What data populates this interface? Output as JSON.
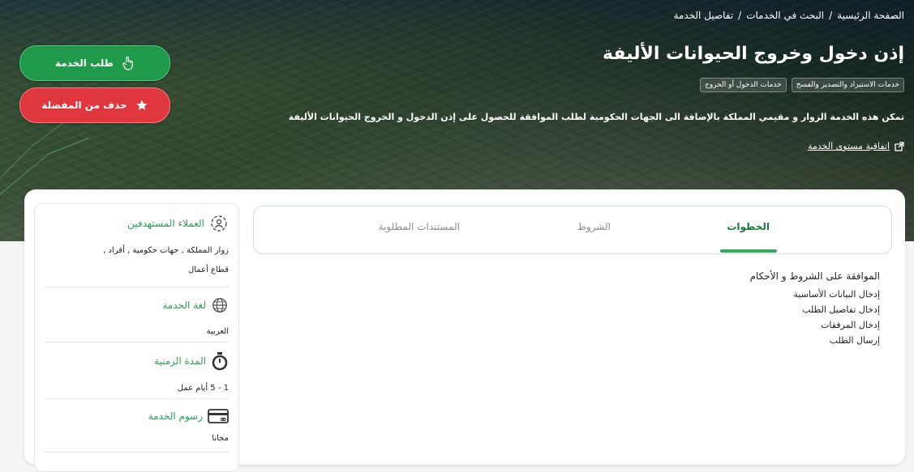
{
  "breadcrumb": {
    "home": "الصفحة الرئيسية",
    "search": "البحث في الخدمات",
    "current": "تفاصيل الخدمة",
    "separator": "/"
  },
  "service": {
    "title": "إذن دخول وخروج الحيوانات الأليفة",
    "tags": [
      "خدمات الاستيراد والتصدير والفسح",
      "خدمات الدخول أو الخروج"
    ],
    "description": "تمكن هذه الخدمة الزوار و مقيمي المملكة بالإضافة الى الجهات الحكومية لطلب الموافقة للحصول على إذن الدخول و الخروج الحيوانات الأليفة",
    "sla_link": "اتفاقية مستوى الخدمة"
  },
  "actions": {
    "request": "طلب الخدمة",
    "remove_favorite": "حذف من المفضلة"
  },
  "tabs": {
    "steps": "الخطوات",
    "conditions": "الشروط",
    "documents": "المستندات المطلوبة"
  },
  "steps": {
    "heading": "الموافقة على الشروط و الأحكام",
    "items": [
      "إدخال البيانات الأساسية",
      "إدخال تفاصيل الطلب",
      "إدخال المرفقات",
      "إرسال الطلب"
    ]
  },
  "sidebar": {
    "audience": {
      "title": "العملاء المستهدفين",
      "line1": "زوار المملكة , جهات حكومية , أفراد ,",
      "line2": "قطاع أعمال"
    },
    "language": {
      "title": "لغة الخدمة",
      "value": "العربية"
    },
    "duration": {
      "title": "المدة الزمنية",
      "value": "1 - 5 أيام عمل"
    },
    "fees": {
      "title": "رسوم الخدمة",
      "value": "مجانا"
    }
  },
  "colors": {
    "green": "#1f9a4a",
    "red": "#e0373f",
    "accent": "#2e9b55"
  }
}
